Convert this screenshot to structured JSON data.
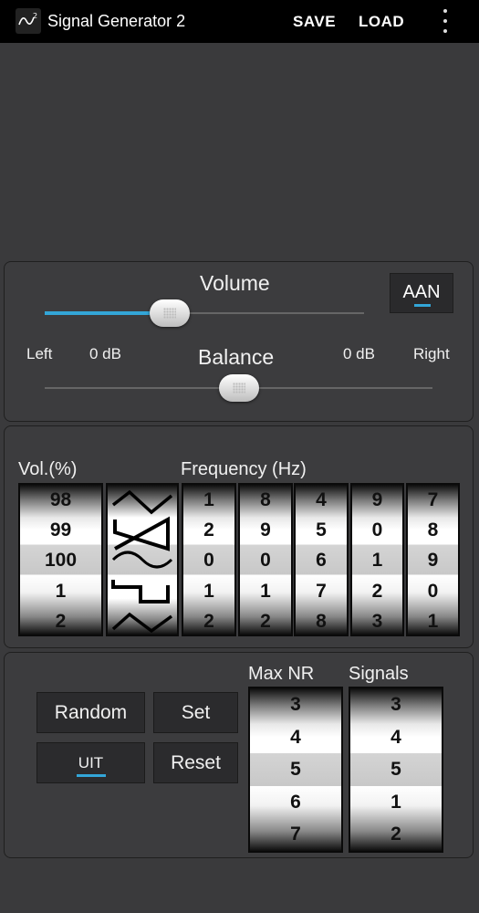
{
  "app": {
    "title": "Signal Generator 2"
  },
  "actions": {
    "save": "SAVE",
    "load": "LOAD"
  },
  "volume": {
    "label": "Volume",
    "toggle_label": "AAN",
    "level": 0.39
  },
  "balance": {
    "label": "Balance",
    "left_label": "Left",
    "right_label": "Right",
    "left_db": "0 dB",
    "right_db": "0 dB",
    "level": 0.5
  },
  "generator": {
    "vol_label": "Vol.(%)",
    "freq_label": "Frequency (Hz)",
    "vol_drum": [
      "98",
      "99",
      "100",
      "1",
      "2"
    ],
    "waveforms": [
      "triangle-wave-icon",
      "sawtooth-wave-icon",
      "sine-wave-icon",
      "square-wave-icon",
      "triangle-wave-icon"
    ],
    "freq_drums": [
      [
        "1",
        "2",
        "0",
        "1",
        "2"
      ],
      [
        "8",
        "9",
        "0",
        "1",
        "2"
      ],
      [
        "4",
        "5",
        "6",
        "7",
        "8"
      ],
      [
        "9",
        "0",
        "1",
        "2",
        "3"
      ],
      [
        "7",
        "8",
        "9",
        "0",
        "1"
      ]
    ]
  },
  "controls": {
    "random": "Random",
    "set": "Set",
    "toggle": "UIT",
    "reset": "Reset",
    "max_nr_label": "Max NR",
    "signals_label": "Signals",
    "max_nr_drum": [
      "3",
      "4",
      "5",
      "6",
      "7"
    ],
    "signals_drum": [
      "3",
      "4",
      "5",
      "1",
      "2"
    ]
  }
}
